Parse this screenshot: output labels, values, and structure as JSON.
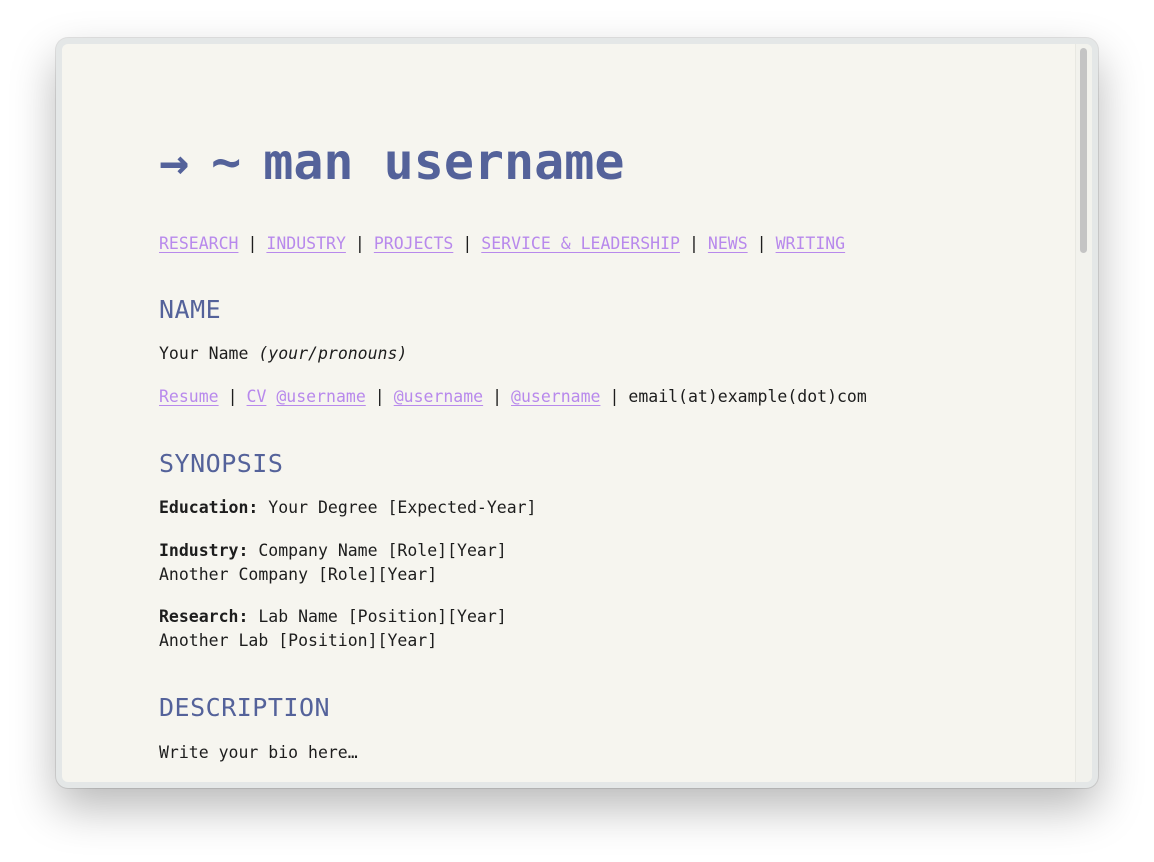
{
  "page": {
    "title_arrow": "→",
    "title_tilde": "~",
    "title_text": "man username"
  },
  "nav": {
    "items": [
      "RESEARCH",
      "INDUSTRY",
      "PROJECTS",
      "SERVICE & LEADERSHIP",
      "NEWS",
      "WRITING"
    ],
    "separator": "|"
  },
  "name_section": {
    "heading": "NAME",
    "name": "Your Name",
    "pronouns": "(your/pronouns)",
    "links": {
      "resume": "Resume",
      "cv": "CV",
      "handle_1": "@username",
      "handle_2": "@username",
      "handle_3": "@username",
      "email": "email(at)example(dot)com"
    }
  },
  "synopsis": {
    "heading": "SYNOPSIS",
    "education_label": "Education:",
    "education_value": "Your Degree [Expected-Year]",
    "industry_label": "Industry:",
    "industry_line1": "Company Name [Role][Year]",
    "industry_line2": "Another Company [Role][Year]",
    "research_label": "Research:",
    "research_line1": "Lab Name [Position][Year]",
    "research_line2": "Another Lab [Position][Year]"
  },
  "description": {
    "heading": "DESCRIPTION",
    "bio": "Write your bio here…"
  },
  "colors": {
    "heading": "#54629a",
    "link": "#b889ec",
    "background": "#f6f5ef",
    "text": "#1d1d1d"
  }
}
